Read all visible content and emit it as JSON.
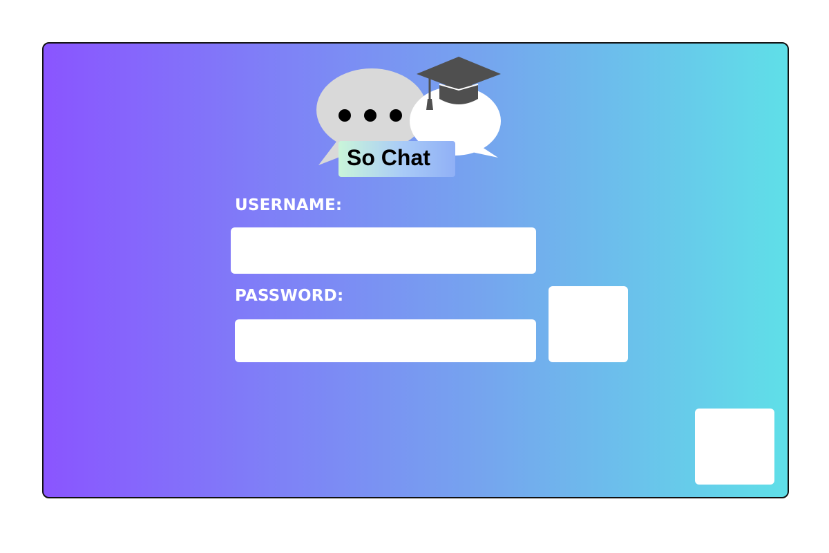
{
  "app": {
    "name": "So Chat"
  },
  "logo": {
    "chat_icon": "speech-bubbles-icon",
    "cap_icon": "graduation-cap-icon",
    "title": "So Chat"
  },
  "form": {
    "username_label": "USERNAME:",
    "username_value": "",
    "password_label": "PASSWORD:",
    "password_value": ""
  },
  "buttons": {
    "login_label": "",
    "corner_label": ""
  },
  "colors": {
    "gradient_start": "#8a55ff",
    "gradient_end": "#5fdfe8",
    "field_background": "#ffffff",
    "label_text": "#ffffff",
    "cap_color": "#4f4f4f",
    "bubble_gray": "#d9d9d9"
  }
}
